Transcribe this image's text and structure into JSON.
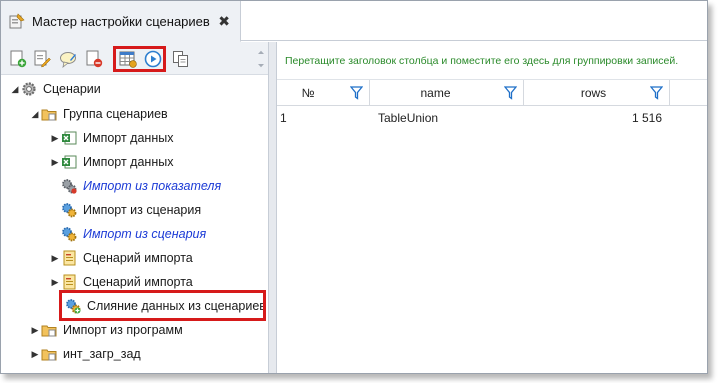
{
  "window": {
    "tab_title": "Мастер настройки сценариев",
    "tab_close_glyph": "✖"
  },
  "toolbar": {
    "buttons": [
      {
        "name": "add-icon"
      },
      {
        "name": "edit-icon"
      },
      {
        "name": "comment-icon"
      },
      {
        "name": "delete-icon"
      },
      {
        "name": "table-settings-icon"
      },
      {
        "name": "run-icon"
      },
      {
        "name": "copy-icon"
      }
    ]
  },
  "tree": {
    "items": [
      {
        "label": "Сценарии",
        "style": "normal"
      },
      {
        "label": "Группа сценариев",
        "style": "normal"
      },
      {
        "label": "Импорт данных",
        "style": "normal"
      },
      {
        "label": "Импорт данных",
        "style": "normal"
      },
      {
        "label": "Импорт из показателя",
        "style": "italic"
      },
      {
        "label": "Импорт из сценария",
        "style": "normal"
      },
      {
        "label": "Импорт из сценария",
        "style": "italic"
      },
      {
        "label": "Сценарий импорта",
        "style": "normal"
      },
      {
        "label": "Сценарий импорта",
        "style": "normal"
      },
      {
        "label": "Слияние данных из сценариев",
        "style": "normal",
        "selected": true
      },
      {
        "label": "Импорт из программ",
        "style": "normal"
      },
      {
        "label": "инт_загр_зад",
        "style": "normal"
      }
    ]
  },
  "grid": {
    "group_hint": "Перетащите заголовок столбца и поместите его здесь для группировки записей.",
    "columns": [
      "№",
      "name",
      "rows"
    ],
    "rows": [
      {
        "num": "1",
        "name": "TableUnion",
        "rows": "1 516"
      }
    ]
  },
  "colors": {
    "highlight": "#d61a1a",
    "italic_link": "#1c3bd6",
    "group_hint": "#2a8a2a",
    "filter": "#1e6fc8"
  }
}
